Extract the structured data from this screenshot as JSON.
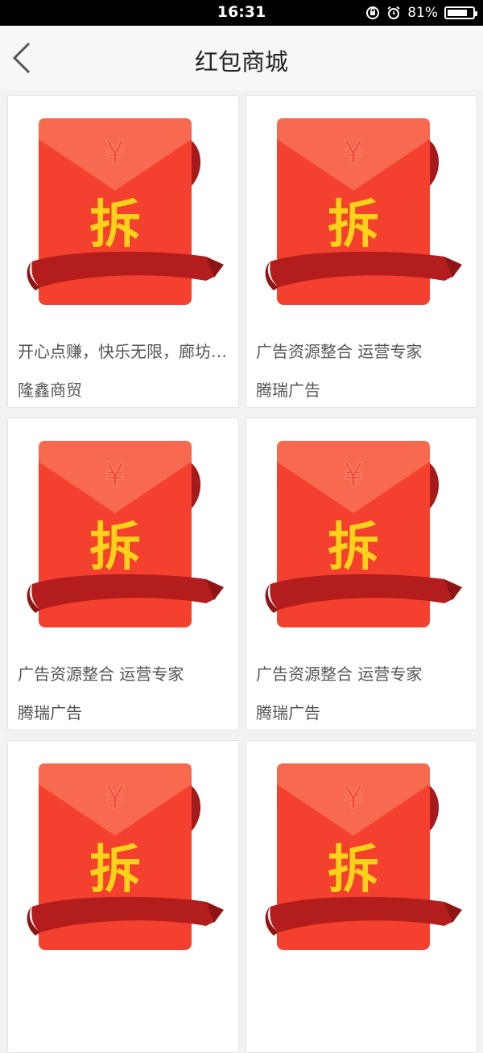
{
  "status_bar": {
    "time": "16:31",
    "battery": "81%",
    "battery_level": 0.81
  },
  "nav": {
    "title": "红包商城",
    "back_icon": "chevron-left-icon"
  },
  "envelope": {
    "badge": "拆",
    "currency": "¥",
    "colors": {
      "body": "#f4402e",
      "flap": "#f86a4f",
      "ribbon": "#b31d1d",
      "badge": "#ffd21a"
    }
  },
  "products": [
    {
      "title": "开心点赚，快乐无限，廊坊隆鑫商贸",
      "shop": "隆鑫商贸"
    },
    {
      "title": "广告资源整合 运营专家",
      "shop": "腾瑞广告"
    },
    {
      "title": "广告资源整合 运营专家",
      "shop": "腾瑞广告"
    },
    {
      "title": "广告资源整合 运营专家",
      "shop": "腾瑞广告"
    },
    {
      "title": "",
      "shop": ""
    },
    {
      "title": "",
      "shop": ""
    }
  ]
}
